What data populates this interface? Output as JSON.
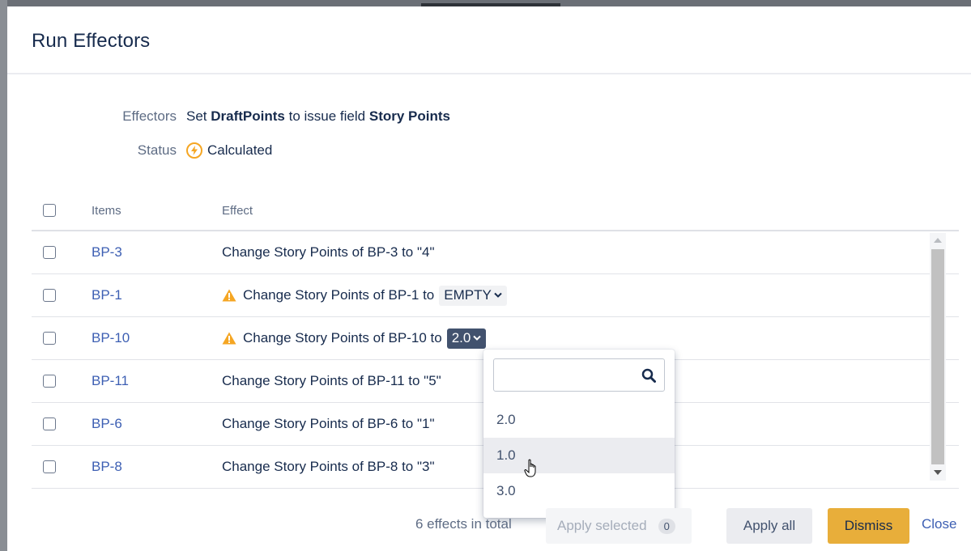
{
  "dialog": {
    "title": "Run Effectors"
  },
  "meta": {
    "effectors_label": "Effectors",
    "effectors_prefix": "Set",
    "effectors_source": "DraftPoints",
    "effectors_middle": "to issue field",
    "effectors_target": "Story Points",
    "status_label": "Status",
    "status_value": "Calculated"
  },
  "table": {
    "headers": {
      "items": "Items",
      "effect": "Effect"
    },
    "rows": [
      {
        "item": "BP-3",
        "effect": "Change Story Points of BP-3 to \"4\""
      },
      {
        "item": "BP-1",
        "effect": "Change Story Points of BP-1 to",
        "chip": "EMPTY"
      },
      {
        "item": "BP-10",
        "effect": "Change Story Points of BP-10 to",
        "chip": "2.0"
      },
      {
        "item": "BP-11",
        "effect": "Change Story Points of BP-11 to \"5\""
      },
      {
        "item": "BP-6",
        "effect": "Change Story Points of BP-6 to \"1\""
      },
      {
        "item": "BP-8",
        "effect": "Change Story Points of BP-8 to \"3\""
      }
    ]
  },
  "dropdown": {
    "search_placeholder": "",
    "options": [
      "2.0",
      "1.0",
      "3.0"
    ],
    "hovered": "1.0"
  },
  "footer": {
    "total_text": "6 effects in total",
    "apply_selected": "Apply selected",
    "selected_count": "0",
    "apply_all": "Apply all",
    "dismiss": "Dismiss",
    "close": "Close"
  },
  "colors": {
    "link": "#3d5fb3",
    "warning": "#f5a623",
    "dismiss_bg": "#e8ae3a",
    "chip_active": "#42526e"
  }
}
